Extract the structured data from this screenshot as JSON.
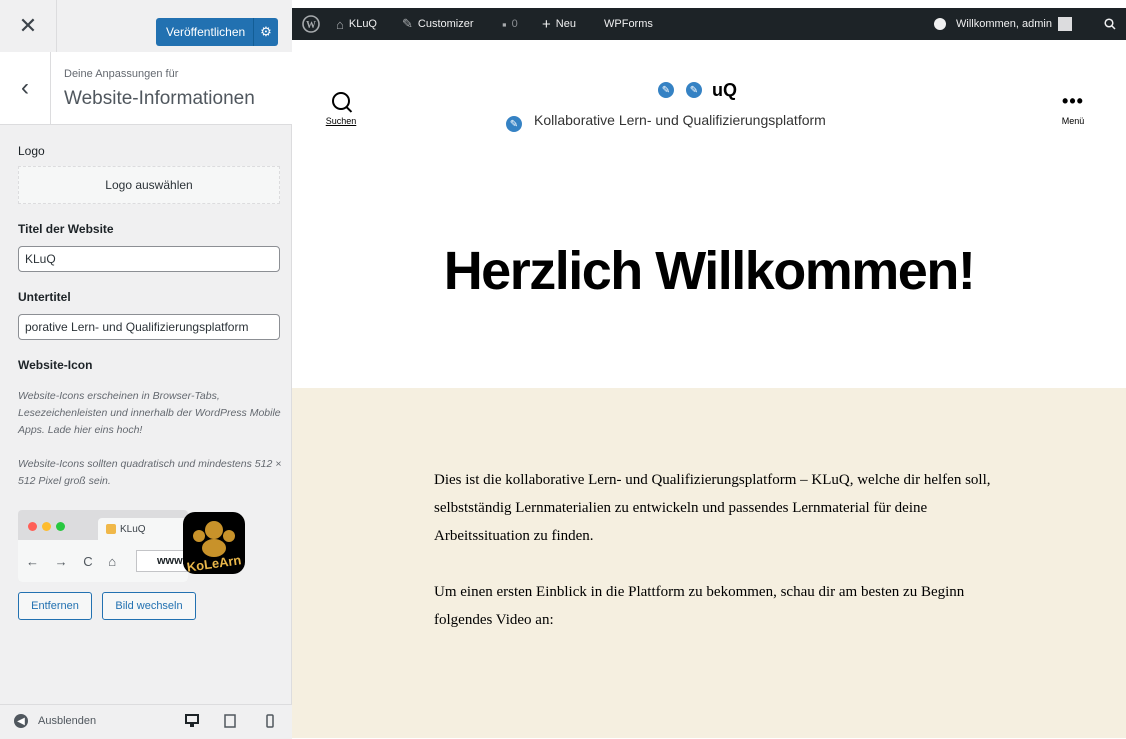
{
  "panel": {
    "close_glyph": "✕",
    "publish_label": "Veröffentlichen",
    "section_subtitle": "Deine Anpassungen für",
    "section_title": "Website-Informationen",
    "logo": {
      "label": "Logo",
      "button": "Logo auswählen"
    },
    "site_title": {
      "label": "Titel der Website",
      "value": "KLuQ"
    },
    "tagline": {
      "label": "Untertitel",
      "value": "porative Lern- und Qualifizierungsplatform"
    },
    "site_icon": {
      "label": "Website-Icon",
      "desc1": "Website-Icons erscheinen in Browser-Tabs, Lesezeichenleisten und innerhalb der WordPress Mobile Apps. Lade hier eins hoch!",
      "desc2": "Website-Icons sollten quadratisch und mindestens 512 × 512 Pixel groß sein.",
      "preview_tab": "KLuQ",
      "preview_url": "www.",
      "icon_text": "KoLeArn",
      "remove_button": "Entfernen",
      "change_button": "Bild wechseln"
    },
    "footer": {
      "collapse_label": "Ausblenden"
    }
  },
  "adminbar": {
    "site_name": "KLuQ",
    "customizer": "Customizer",
    "comments_count": "0",
    "new": "Neu",
    "wpforms": "WPForms",
    "greeting": "Willkommen, admin"
  },
  "preview": {
    "search_label": "Suchen",
    "menu_label": "Menü",
    "site_title": "uQ",
    "tagline": "Kollaborative Lern- und Qualifizierungsplatform",
    "welcome": "Herzlich Willkommen!",
    "paragraph1": "Dies ist die kollaborative Lern- und Qualifizierungsplatform – KLuQ, welche dir helfen soll, selbstständig Lernmaterialien zu entwickeln und passendes Lernmaterial für deine Arbeitssituation zu finden.",
    "paragraph2": "Um einen ersten Einblick in die Plattform zu bekommen, schau dir am besten zu Beginn folgendes Video an:"
  },
  "colors": {
    "accent": "#2271b1",
    "adminbar": "#1d2327",
    "content_bg": "#f5efe0"
  }
}
